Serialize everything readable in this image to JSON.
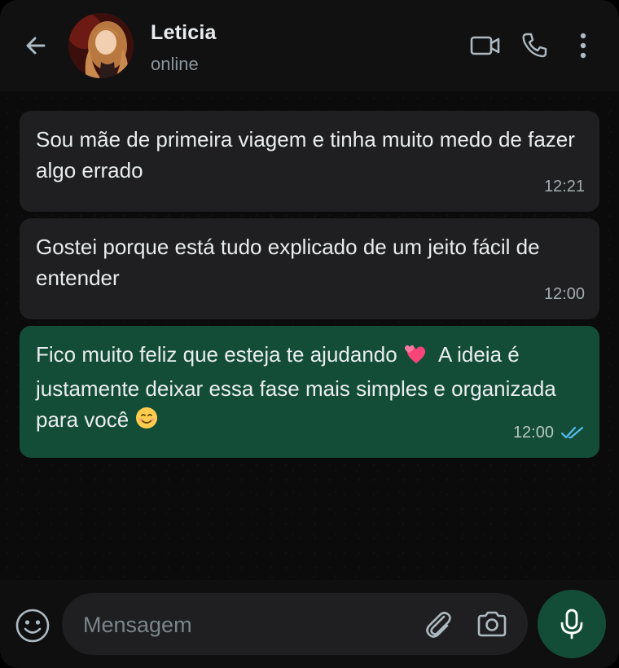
{
  "colors": {
    "header_bg": "#111112",
    "chat_bg": "#0b0b0b",
    "incoming_bubble": "#1f1f21",
    "outgoing_bubble": "#144d37",
    "read_ticks": "#53bdeb",
    "icon": "#aebac1"
  },
  "header": {
    "contact_name": "Leticia",
    "status": "online",
    "icons": [
      "back-arrow-icon",
      "video-call-icon",
      "phone-icon",
      "more-vert-icon"
    ]
  },
  "messages": [
    {
      "direction": "incoming",
      "text": "Sou mãe de primeira viagem e tinha muito medo de fazer algo errado",
      "time": "12:21"
    },
    {
      "direction": "incoming",
      "text": "Gostei porque está tudo explicado de um jeito fácil de entender",
      "time": "12:00"
    },
    {
      "direction": "outgoing",
      "text_part1": "Fico muito feliz que esteja te ajudando",
      "emoji1": "two-hearts",
      "text_part2": "A ideia é justamente deixar essa fase mais simples e organizada para você",
      "emoji2": "smiling-face",
      "time": "12:00",
      "status": "read"
    }
  ],
  "composer": {
    "placeholder": "Mensagem",
    "icons": [
      "emoji-icon",
      "attach-icon",
      "camera-icon",
      "mic-icon"
    ]
  }
}
